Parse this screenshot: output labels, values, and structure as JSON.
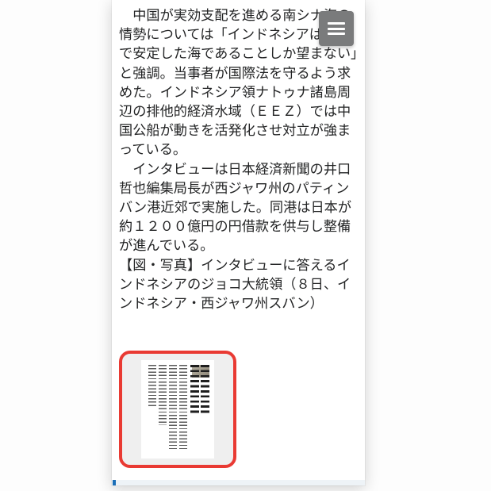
{
  "article": {
    "paragraph1": "中国が実効支配を進める南シナ海の情勢については「インドネシアは平和で安定した海であることしか望まない」と強調。当事者が国際法を守るよう求めた。インドネシア領ナトゥナ諸島周辺の排他的経済水域（ＥＥＺ）では中国公船が動きを活発化させ対立が強まっている。",
    "paragraph2": "インタビューは日本経済新聞の井口哲也編集局長が西ジャワ州のパティンバン港近郊で実施した。同港は日本が約１２００億円の円借款を供与し整備が進んでいる。",
    "caption": "【図・写真】インタビューに答えるインドネシアのジョコ大統領（８日、インドネシア・西ジャワ州スバン）"
  },
  "menu": {
    "aria": "メニュー"
  },
  "thumbnail": {
    "aria": "記事紙面サムネイル"
  }
}
